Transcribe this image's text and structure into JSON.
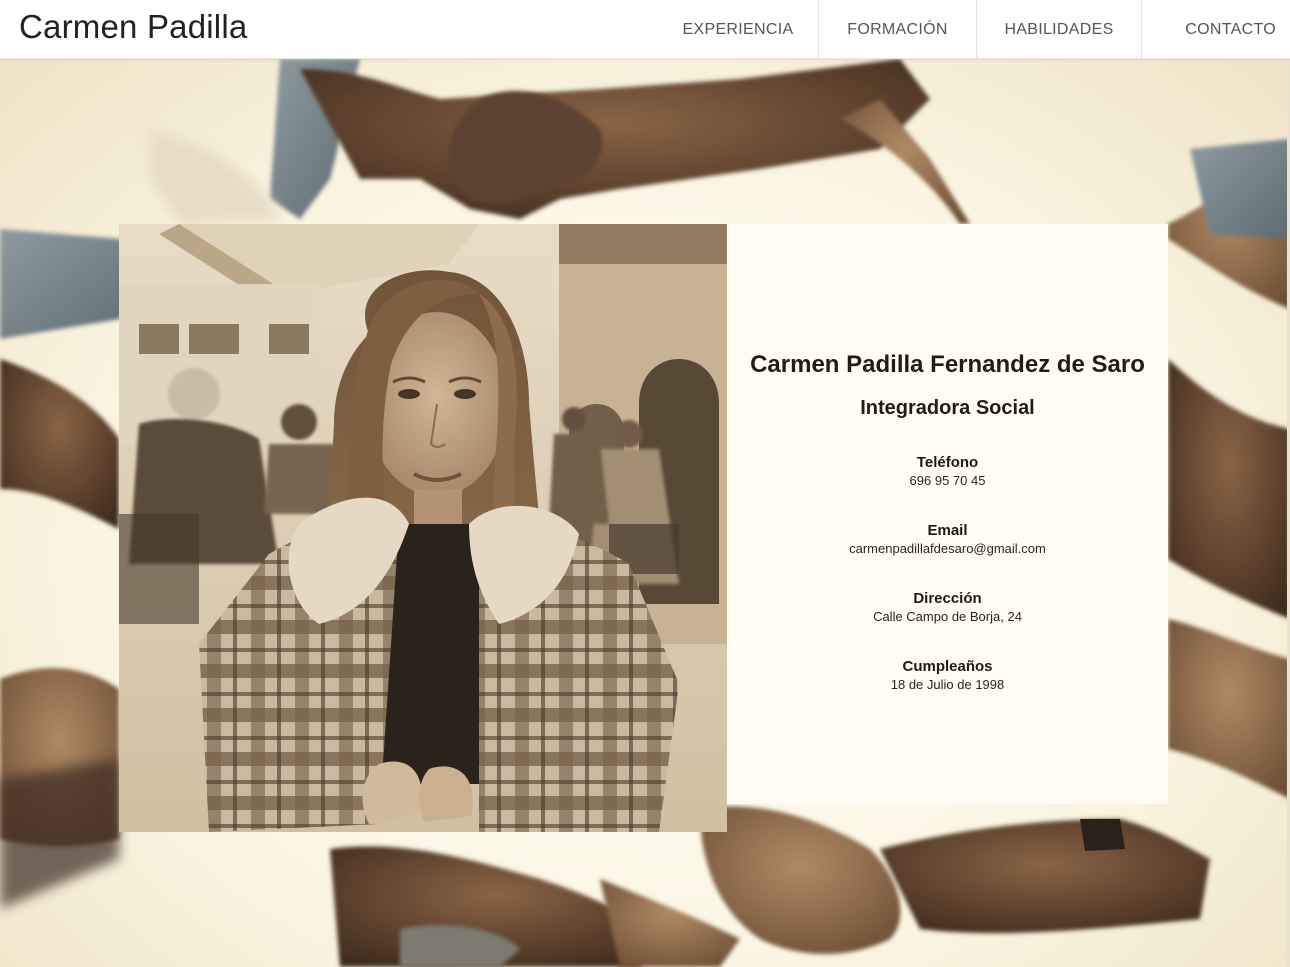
{
  "header": {
    "brand": "Carmen Padilla",
    "nav": [
      {
        "label": "EXPERIENCIA"
      },
      {
        "label": "FORMACIÓN"
      },
      {
        "label": "HABILIDADES"
      },
      {
        "label": "CONTACTO"
      }
    ]
  },
  "profile": {
    "name": "Carmen Padilla Fernandez de Saro",
    "role": "Integradora Social",
    "fields": [
      {
        "label": "Teléfono",
        "value": "696 95 70 45"
      },
      {
        "label": "Email",
        "value": "carmenpadillafdesaro@gmail.com"
      },
      {
        "label": "Dirección",
        "value": "Calle Campo de Borja, 24"
      },
      {
        "label": "Cumpleaños",
        "value": "18 de Julio de 1998"
      }
    ]
  },
  "colors": {
    "background": "#fffdf2",
    "sepia": "#8a6a48",
    "text": "#221c14"
  }
}
